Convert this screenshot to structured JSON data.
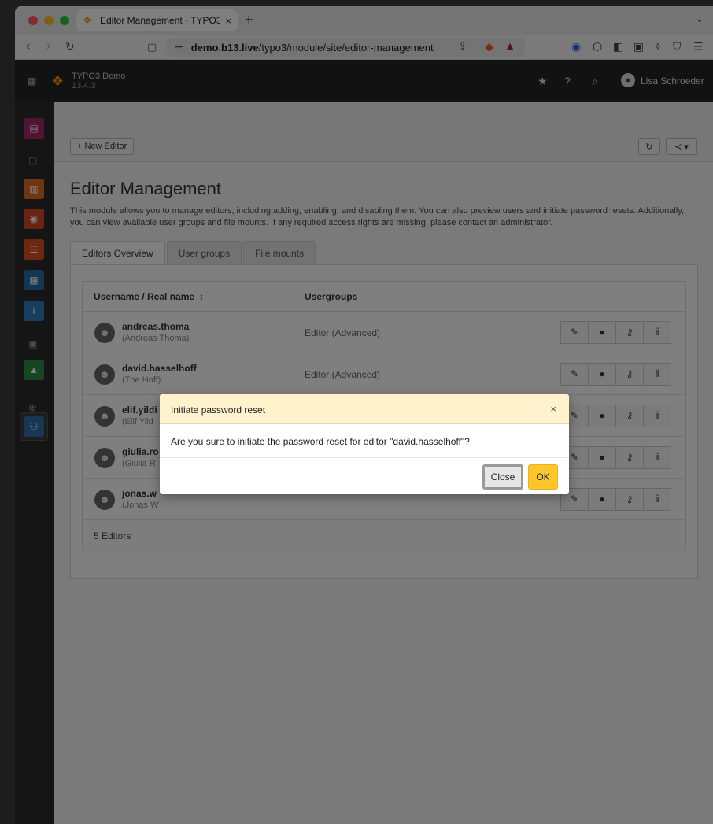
{
  "browser": {
    "tab_title": "Editor Management · TYPO3",
    "tab_close": "×",
    "new_tab": "+",
    "url_domain": "demo.b13.live",
    "url_path": "/typo3/module/site/editor-management"
  },
  "topbar": {
    "site_name": "TYPO3 Demo",
    "version": "13.4.3",
    "user_name": "Lisa Schroeder"
  },
  "docheader": {
    "new_editor_label": "+ New Editor"
  },
  "page": {
    "title": "Editor Management",
    "description": "This module allows you to manage editors, including adding, enabling, and disabling them. You can also preview users and initiate password resets. Additionally, you can view available user groups and file mounts. If any required access rights are missing, please contact an administrator."
  },
  "tabs": [
    {
      "label": "Editors Overview"
    },
    {
      "label": "User groups"
    },
    {
      "label": "File mounts"
    }
  ],
  "table": {
    "col_username": "Username / Real name",
    "sort_indicator": "↕",
    "col_usergroups": "Usergroups",
    "rows": [
      {
        "username": "andreas.thoma",
        "realname": "(Andreas Thoma)",
        "group": "Editor (Advanced)"
      },
      {
        "username": "david.hasselhoff",
        "realname": "(The Hoff)",
        "group": "Editor (Advanced)"
      },
      {
        "username": "elif.yildi",
        "realname": "(Elif Yild",
        "group": ""
      },
      {
        "username": "giulia.ro",
        "realname": "(Giulia R",
        "group": ""
      },
      {
        "username": "jonas.w",
        "realname": "(Jonas W",
        "group": ""
      }
    ],
    "footer": "5 Editors"
  },
  "modal": {
    "title": "Initiate password reset",
    "close_x": "×",
    "message": "Are you sure to initiate the password reset for editor \"david.hasselhoff\"?",
    "close_label": "Close",
    "ok_label": "OK"
  },
  "colors": {
    "accent": "#ffc629",
    "modal_header": "#fff3cd",
    "typo3_orange": "#f49700"
  },
  "icons": {
    "edit": "✎",
    "toggle": "●",
    "key": "⚷",
    "switch_user": "ⅱ"
  }
}
